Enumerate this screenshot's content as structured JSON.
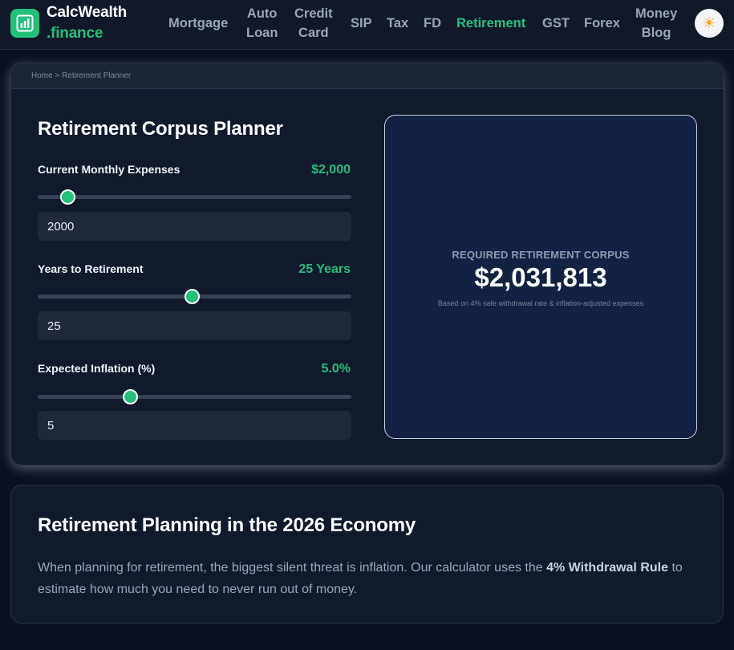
{
  "navbar": {
    "brand_line1": "CalcWealth",
    "brand_line2": ".finance",
    "items": [
      {
        "line1": "Mortgage",
        "line2": ""
      },
      {
        "line1": "Auto",
        "line2": "Loan"
      },
      {
        "line1": "Credit",
        "line2": "Card"
      },
      {
        "line1": "SIP",
        "line2": ""
      },
      {
        "line1": "Tax",
        "line2": ""
      },
      {
        "line1": "FD",
        "line2": ""
      },
      {
        "line1": "Retirement",
        "line2": ""
      },
      {
        "line1": "GST",
        "line2": ""
      },
      {
        "line1": "Forex",
        "line2": ""
      },
      {
        "line1": "Money",
        "line2": "Blog"
      }
    ],
    "active_item": "Retirement",
    "theme_icon": "sun-icon",
    "theme_glyph": "☀"
  },
  "breadcrumb": "Home > Retirement Planner",
  "calculator": {
    "title": "Retirement Corpus Planner",
    "fields": [
      {
        "label": "Current Monthly Expenses",
        "display_value": "$2,000",
        "input_value": "2000",
        "slider_fraction": 0.095
      },
      {
        "label": "Years to Retirement",
        "display_value": "25 Years",
        "input_value": "25",
        "slider_fraction": 0.49
      },
      {
        "label": "Expected Inflation (%)",
        "display_value": "5.0%",
        "input_value": "5",
        "slider_fraction": 0.295
      }
    ],
    "result": {
      "label": "REQUIRED RETIREMENT CORPUS",
      "value": "$2,031,813",
      "note": "Based on 4% safe withdrawal rate & inflation-adjusted expenses"
    }
  },
  "article": {
    "title": "Retirement Planning in the 2026 Economy",
    "body_before": "When planning for retirement, the biggest silent threat is inflation. Our calculator uses the ",
    "body_bold": "4% Withdrawal Rule",
    "body_after": " to estimate how much you need to never run out of money."
  },
  "colors": {
    "accent": "#22c07a",
    "background": "#0a1020",
    "card": "#111a2b",
    "result_panel": "#132242"
  }
}
